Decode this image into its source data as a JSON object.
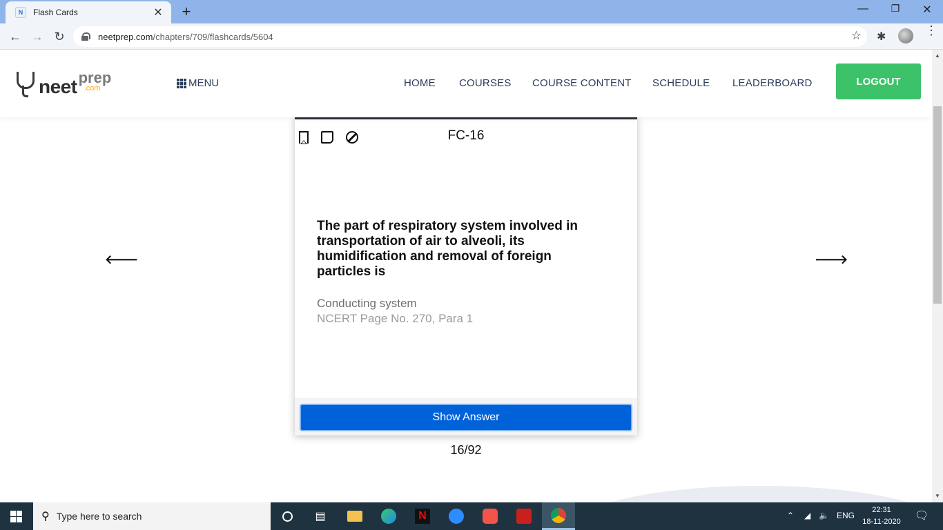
{
  "browser": {
    "tab_title": "Flash Cards",
    "tab_favicon_text": "N",
    "url_domain": "neetprep.com",
    "url_path": "/chapters/709/flashcards/5604"
  },
  "header": {
    "logo_main": "neet",
    "logo_sub": "prep",
    "logo_tld": ".com",
    "menu_label": "MENU",
    "nav": [
      "HOME",
      "COURSES",
      "COURSE CONTENT",
      "SCHEDULE",
      "LEADERBOARD"
    ],
    "logout_label": "LOGOUT"
  },
  "card": {
    "label": "FC-16",
    "question": "The part of respiratory system involved in transportation of air to alveoli, its humidification and removal of foreign particles is",
    "answer": "Conducting system",
    "reference": "NCERT Page No. 270, Para 1",
    "show_answer_label": "Show Answer",
    "counter": "16/92"
  },
  "taskbar": {
    "search_placeholder": "Type here to search",
    "language": "ENG",
    "time": "22:31",
    "date": "18-11-2020"
  },
  "colors": {
    "logout_bg": "#3cc36a",
    "show_answer_bg": "#0062d9",
    "nav_text": "#2c3e5a"
  }
}
